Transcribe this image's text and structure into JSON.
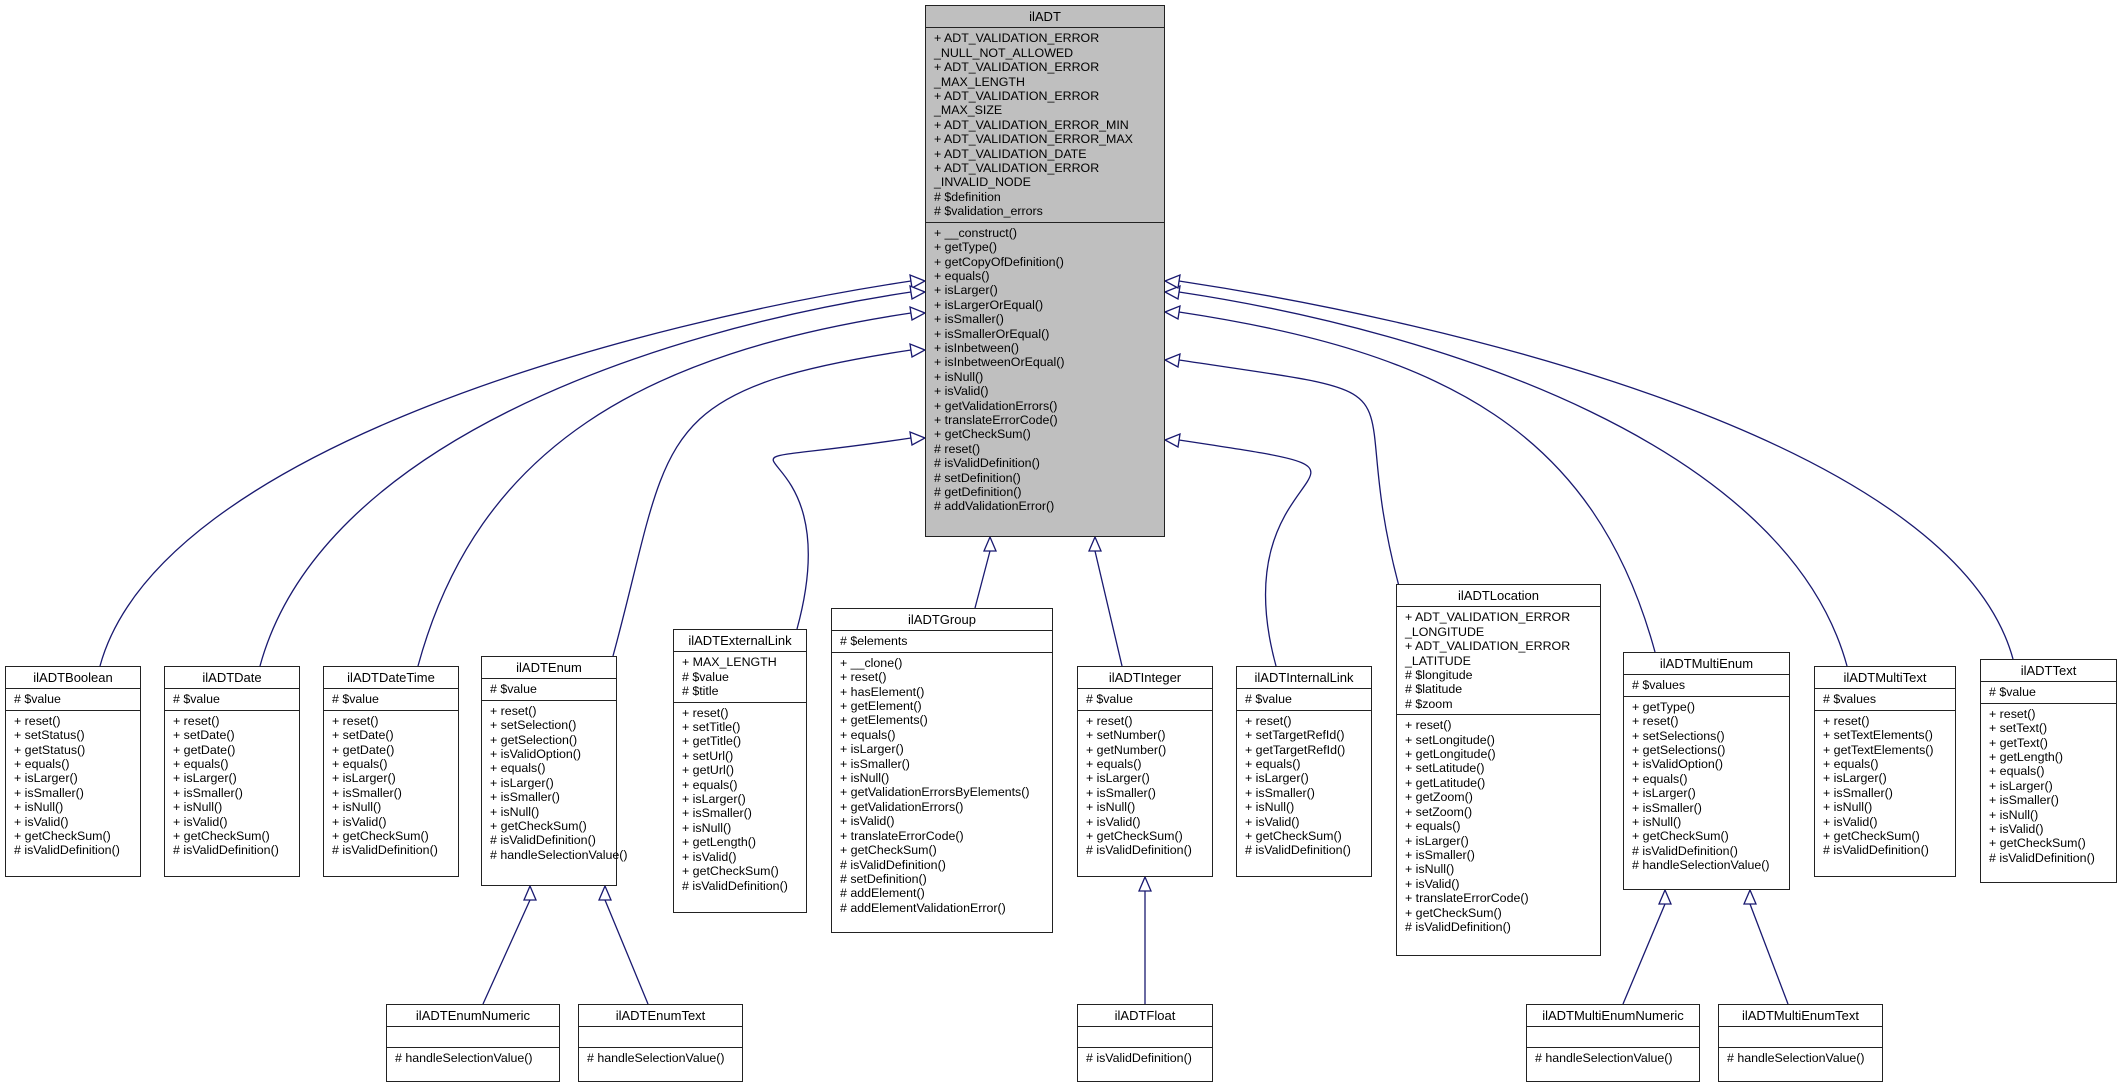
{
  "colors": {
    "edge": "#191970",
    "base_fill": "#bfbfbf",
    "box_fill": "#ffffff",
    "border": "#222222"
  },
  "classes": {
    "ilADT": {
      "name": "ilADT",
      "attributes": [
        "+ ADT_VALIDATION_ERROR",
        "_NULL_NOT_ALLOWED",
        "+ ADT_VALIDATION_ERROR",
        "_MAX_LENGTH",
        "+ ADT_VALIDATION_ERROR",
        "_MAX_SIZE",
        "+ ADT_VALIDATION_ERROR_MIN",
        "+ ADT_VALIDATION_ERROR_MAX",
        "+ ADT_VALIDATION_DATE",
        "+ ADT_VALIDATION_ERROR",
        "_INVALID_NODE",
        "# $definition",
        "# $validation_errors"
      ],
      "methods": [
        "+ __construct()",
        "+ getType()",
        "+ getCopyOfDefinition()",
        "+ equals()",
        "+ isLarger()",
        "+ isLargerOrEqual()",
        "+ isSmaller()",
        "+ isSmallerOrEqual()",
        "+ isInbetween()",
        "+ isInbetweenOrEqual()",
        "+ isNull()",
        "+ isValid()",
        "+ getValidationErrors()",
        "+ translateErrorCode()",
        "+ getCheckSum()",
        "# reset()",
        "# isValidDefinition()",
        "# setDefinition()",
        "# getDefinition()",
        "# addValidationError()"
      ]
    },
    "ilADTBoolean": {
      "name": "ilADTBoolean",
      "attributes": [
        "# $value"
      ],
      "methods": [
        "+ reset()",
        "+ setStatus()",
        "+ getStatus()",
        "+ equals()",
        "+ isLarger()",
        "+ isSmaller()",
        "+ isNull()",
        "+ isValid()",
        "+ getCheckSum()",
        "# isValidDefinition()"
      ]
    },
    "ilADTDate": {
      "name": "ilADTDate",
      "attributes": [
        "# $value"
      ],
      "methods": [
        "+ reset()",
        "+ setDate()",
        "+ getDate()",
        "+ equals()",
        "+ isLarger()",
        "+ isSmaller()",
        "+ isNull()",
        "+ isValid()",
        "+ getCheckSum()",
        "# isValidDefinition()"
      ]
    },
    "ilADTDateTime": {
      "name": "ilADTDateTime",
      "attributes": [
        "# $value"
      ],
      "methods": [
        "+ reset()",
        "+ setDate()",
        "+ getDate()",
        "+ equals()",
        "+ isLarger()",
        "+ isSmaller()",
        "+ isNull()",
        "+ isValid()",
        "+ getCheckSum()",
        "# isValidDefinition()"
      ]
    },
    "ilADTEnum": {
      "name": "ilADTEnum",
      "attributes": [
        "# $value"
      ],
      "methods": [
        "+ reset()",
        "+ setSelection()",
        "+ getSelection()",
        "+ isValidOption()",
        "+ equals()",
        "+ isLarger()",
        "+ isSmaller()",
        "+ isNull()",
        "+ getCheckSum()",
        "# isValidDefinition()",
        "# handleSelectionValue()"
      ]
    },
    "ilADTExternalLink": {
      "name": "ilADTExternalLink",
      "attributes": [
        "+ MAX_LENGTH",
        "# $value",
        "# $title"
      ],
      "methods": [
        "+ reset()",
        "+ setTitle()",
        "+ getTitle()",
        "+ setUrl()",
        "+ getUrl()",
        "+ equals()",
        "+ isLarger()",
        "+ isSmaller()",
        "+ isNull()",
        "+ getLength()",
        "+ isValid()",
        "+ getCheckSum()",
        "# isValidDefinition()"
      ]
    },
    "ilADTGroup": {
      "name": "ilADTGroup",
      "attributes": [
        "# $elements"
      ],
      "methods": [
        "+ __clone()",
        "+ reset()",
        "+ hasElement()",
        "+ getElement()",
        "+ getElements()",
        "+ equals()",
        "+ isLarger()",
        "+ isSmaller()",
        "+ isNull()",
        "+ getValidationErrorsByElements()",
        "+ getValidationErrors()",
        "+ isValid()",
        "+ translateErrorCode()",
        "+ getCheckSum()",
        "# isValidDefinition()",
        "# setDefinition()",
        "# addElement()",
        "# addElementValidationError()"
      ]
    },
    "ilADTInteger": {
      "name": "ilADTInteger",
      "attributes": [
        "# $value"
      ],
      "methods": [
        "+ reset()",
        "+ setNumber()",
        "+ getNumber()",
        "+ equals()",
        "+ isLarger()",
        "+ isSmaller()",
        "+ isNull()",
        "+ isValid()",
        "+ getCheckSum()",
        "# isValidDefinition()"
      ]
    },
    "ilADTInternalLink": {
      "name": "ilADTInternalLink",
      "attributes": [
        "# $value"
      ],
      "methods": [
        "+ reset()",
        "+ setTargetRefId()",
        "+ getTargetRefId()",
        "+ equals()",
        "+ isLarger()",
        "+ isSmaller()",
        "+ isNull()",
        "+ isValid()",
        "+ getCheckSum()",
        "# isValidDefinition()"
      ]
    },
    "ilADTLocation": {
      "name": "ilADTLocation",
      "attributes": [
        "+ ADT_VALIDATION_ERROR",
        "_LONGITUDE",
        "+ ADT_VALIDATION_ERROR",
        "_LATITUDE",
        "# $longitude",
        "# $latitude",
        "# $zoom"
      ],
      "methods": [
        "+ reset()",
        "+ setLongitude()",
        "+ getLongitude()",
        "+ setLatitude()",
        "+ getLatitude()",
        "+ getZoom()",
        "+ setZoom()",
        "+ equals()",
        "+ isLarger()",
        "+ isSmaller()",
        "+ isNull()",
        "+ isValid()",
        "+ translateErrorCode()",
        "+ getCheckSum()",
        "# isValidDefinition()"
      ]
    },
    "ilADTMultiEnum": {
      "name": "ilADTMultiEnum",
      "attributes": [
        "# $values"
      ],
      "methods": [
        "+ getType()",
        "+ reset()",
        "+ setSelections()",
        "+ getSelections()",
        "+ isValidOption()",
        "+ equals()",
        "+ isLarger()",
        "+ isSmaller()",
        "+ isNull()",
        "+ getCheckSum()",
        "# isValidDefinition()",
        "# handleSelectionValue()"
      ]
    },
    "ilADTMultiText": {
      "name": "ilADTMultiText",
      "attributes": [
        "# $values"
      ],
      "methods": [
        "+ reset()",
        "+ setTextElements()",
        "+ getTextElements()",
        "+ equals()",
        "+ isLarger()",
        "+ isSmaller()",
        "+ isNull()",
        "+ isValid()",
        "+ getCheckSum()",
        "# isValidDefinition()"
      ]
    },
    "ilADTText": {
      "name": "ilADTText",
      "attributes": [
        "# $value"
      ],
      "methods": [
        "+ reset()",
        "+ setText()",
        "+ getText()",
        "+ getLength()",
        "+ equals()",
        "+ isLarger()",
        "+ isSmaller()",
        "+ isNull()",
        "+ isValid()",
        "+ getCheckSum()",
        "# isValidDefinition()"
      ]
    },
    "ilADTEnumNumeric": {
      "name": "ilADTEnumNumeric",
      "attributes": [],
      "methods": [
        "# handleSelectionValue()"
      ]
    },
    "ilADTEnumText": {
      "name": "ilADTEnumText",
      "attributes": [],
      "methods": [
        "# handleSelectionValue()"
      ]
    },
    "ilADTFloat": {
      "name": "ilADTFloat",
      "attributes": [],
      "methods": [
        "# isValidDefinition()"
      ]
    },
    "ilADTMultiEnumNumeric": {
      "name": "ilADTMultiEnumNumeric",
      "attributes": [],
      "methods": [
        "# handleSelectionValue()"
      ]
    },
    "ilADTMultiEnumText": {
      "name": "ilADTMultiEnumText",
      "attributes": [],
      "methods": [
        "# handleSelectionValue()"
      ]
    }
  },
  "inheritance": [
    {
      "child": "ilADTBoolean",
      "parent": "ilADT"
    },
    {
      "child": "ilADTDate",
      "parent": "ilADT"
    },
    {
      "child": "ilADTDateTime",
      "parent": "ilADT"
    },
    {
      "child": "ilADTEnum",
      "parent": "ilADT"
    },
    {
      "child": "ilADTExternalLink",
      "parent": "ilADT"
    },
    {
      "child": "ilADTGroup",
      "parent": "ilADT"
    },
    {
      "child": "ilADTInteger",
      "parent": "ilADT"
    },
    {
      "child": "ilADTInternalLink",
      "parent": "ilADT"
    },
    {
      "child": "ilADTLocation",
      "parent": "ilADT"
    },
    {
      "child": "ilADTMultiEnum",
      "parent": "ilADT"
    },
    {
      "child": "ilADTMultiText",
      "parent": "ilADT"
    },
    {
      "child": "ilADTText",
      "parent": "ilADT"
    },
    {
      "child": "ilADTEnumNumeric",
      "parent": "ilADTEnum"
    },
    {
      "child": "ilADTEnumText",
      "parent": "ilADTEnum"
    },
    {
      "child": "ilADTFloat",
      "parent": "ilADTInteger"
    },
    {
      "child": "ilADTMultiEnumNumeric",
      "parent": "ilADTMultiEnum"
    },
    {
      "child": "ilADTMultiEnumText",
      "parent": "ilADTMultiEnum"
    }
  ]
}
